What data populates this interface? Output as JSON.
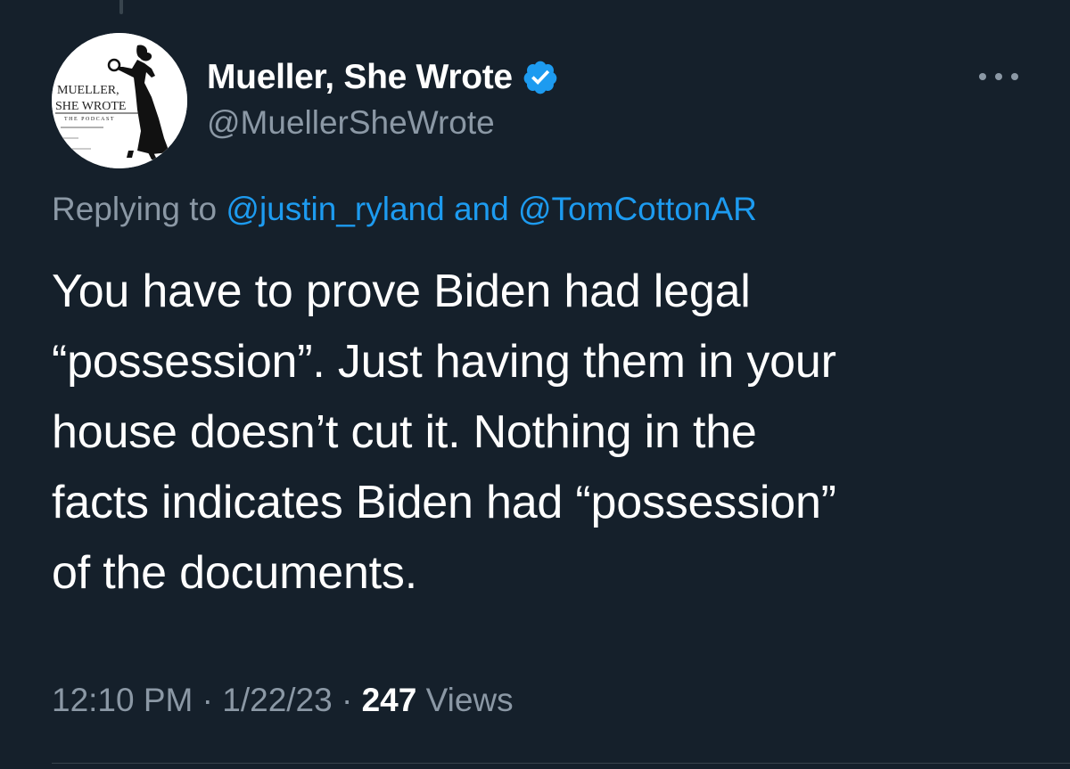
{
  "tweet": {
    "author": {
      "display_name": "Mueller, She Wrote",
      "handle": "@MuellerSheWrote",
      "verified": true,
      "avatar": {
        "icon": "podcast-logo-icon",
        "logo_text_line1": "MUELLER,",
        "logo_text_line2": "SHE WROTE",
        "logo_subtitle": "THE PODCAST"
      }
    },
    "more_icon": "more-options-icon",
    "reply": {
      "prefix": "Replying to ",
      "user1": "@justin_ryland",
      "connector": " and ",
      "user2": "@TomCottonAR"
    },
    "text_lines": [
      "You have to prove Biden had legal",
      "“possession”. Just having them in your",
      "house doesn’t cut it. Nothing in the",
      "facts indicates Biden had “possession”",
      "of the documents."
    ],
    "meta": {
      "time": "12:10 PM",
      "separator": " · ",
      "date": "1/22/23",
      "views_count": "247",
      "views_label": " Views"
    }
  },
  "colors": {
    "background": "#15202b",
    "text_primary": "#ffffff",
    "text_secondary": "#8b98a5",
    "link": "#1d9bf0",
    "verified_badge": "#1d9bf0"
  }
}
